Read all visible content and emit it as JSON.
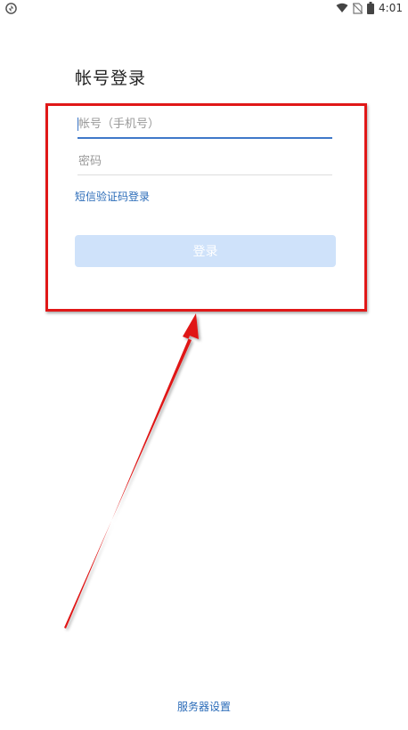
{
  "status_bar": {
    "time": "4:01",
    "icons": [
      "sync-icon",
      "wifi-icon",
      "no-sim-icon",
      "battery-icon"
    ]
  },
  "login": {
    "title": "帐号登录",
    "account_placeholder": "帐号（手机号）",
    "account_value": "",
    "password_placeholder": "密码",
    "password_value": "",
    "sms_login_link": "短信验证码登录",
    "login_button": "登录"
  },
  "footer": {
    "server_settings": "服务器设置"
  },
  "colors": {
    "accent": "#3f79c9",
    "link": "#2a6bb8",
    "button_disabled": "#cfe2fa",
    "annotation_red": "#e01818"
  }
}
